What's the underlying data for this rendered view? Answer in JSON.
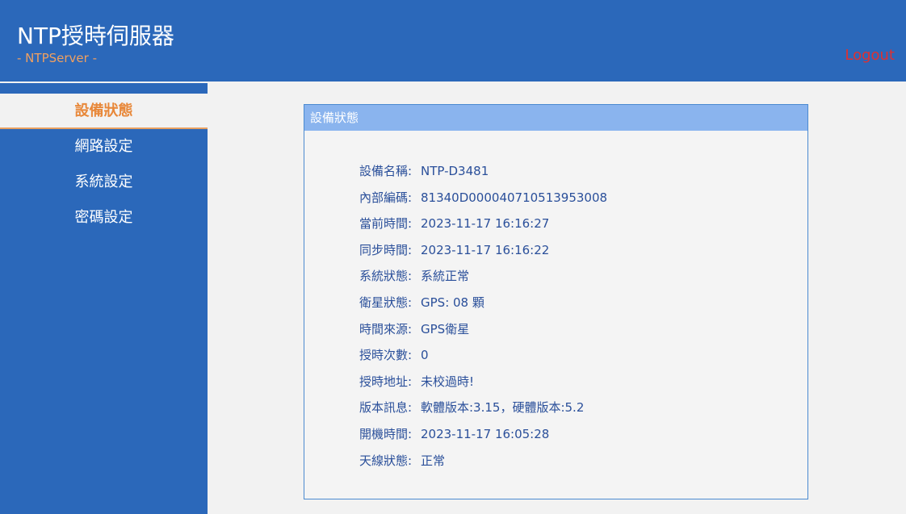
{
  "header": {
    "title": "NTP授時伺服器",
    "subtitle": "- NTPServer -",
    "logout": "Logout"
  },
  "sidebar": {
    "items": [
      {
        "label": "設備狀態",
        "active": true
      },
      {
        "label": "網路設定",
        "active": false
      },
      {
        "label": "系統設定",
        "active": false
      },
      {
        "label": "密碼設定",
        "active": false
      }
    ]
  },
  "panel": {
    "title": "設備狀態",
    "rows": [
      {
        "label": "設備名稱:",
        "value": "NTP-D3481"
      },
      {
        "label": "內部編碼:",
        "value": "81340D000040710513953008"
      },
      {
        "label": "當前時間:",
        "value": "2023-11-17 16:16:27"
      },
      {
        "label": "同步時間:",
        "value": "2023-11-17 16:16:22"
      },
      {
        "label": "系統狀態:",
        "value": "系統正常"
      },
      {
        "label": "衛星狀態:",
        "value": "GPS: 08 顆"
      },
      {
        "label": "時間來源:",
        "value": "GPS衛星"
      },
      {
        "label": "授時次數:",
        "value": "0"
      },
      {
        "label": "授時地址:",
        "value": "未校過時!"
      },
      {
        "label": "版本訊息:",
        "value": "軟體版本:3.15，硬體版本:5.2"
      },
      {
        "label": "開機時間:",
        "value": "2023-11-17 16:05:28"
      },
      {
        "label": "天線狀態:",
        "value": "正常"
      }
    ]
  }
}
